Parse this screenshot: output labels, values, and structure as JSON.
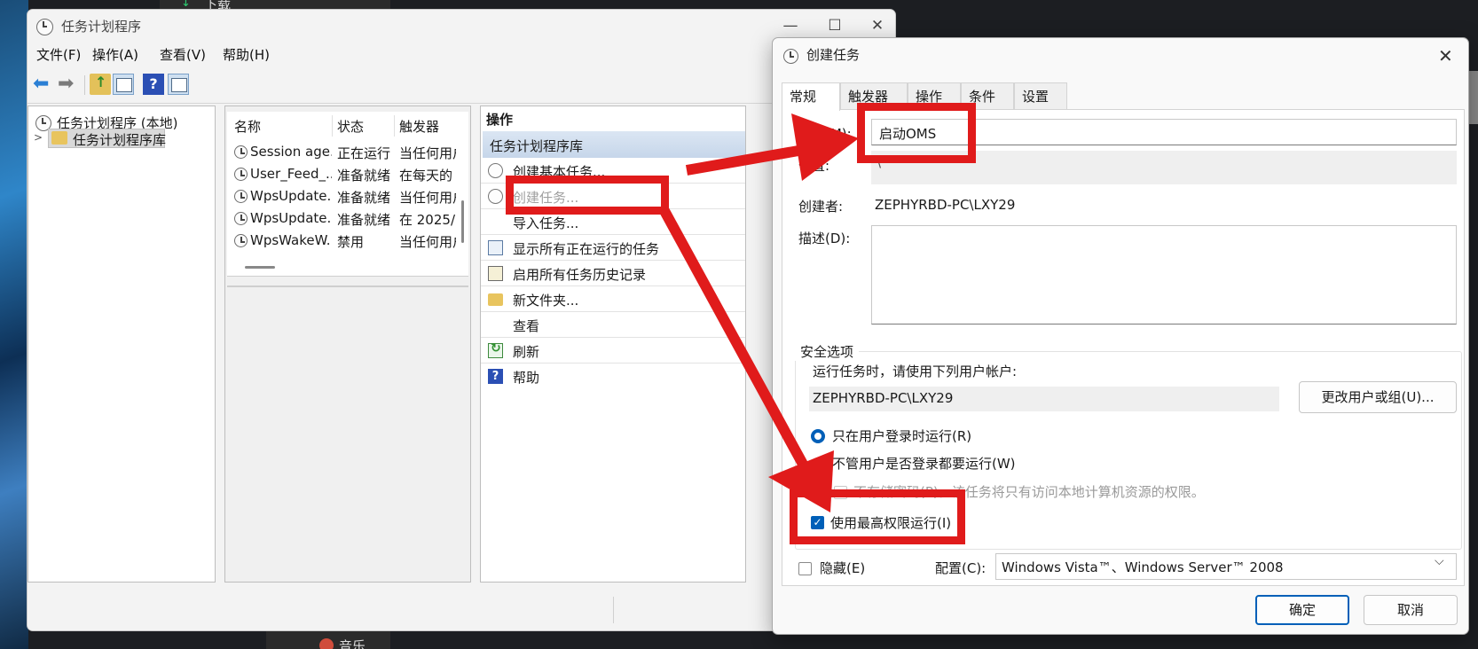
{
  "desktop": {
    "top_label": "下载",
    "bottom_label": "音乐"
  },
  "main_window": {
    "title": "任务计划程序",
    "controls": {
      "minimize": "—",
      "maximize": "☐",
      "close": "✕"
    },
    "menu": [
      "文件(F)",
      "操作(A)",
      "查看(V)",
      "帮助(H)"
    ],
    "tree": {
      "root": "任务计划程序 (本地)",
      "child": "任务计划程序库"
    },
    "task_list": {
      "columns": [
        "名称",
        "状态",
        "触发器"
      ],
      "rows": [
        {
          "name": "Session age...",
          "status": "正在运行",
          "trigger": "当任何用户"
        },
        {
          "name": "User_Feed_...",
          "status": "准备就绪",
          "trigger": "在每天的"
        },
        {
          "name": "WpsUpdate...",
          "status": "准备就绪",
          "trigger": "当任何用户"
        },
        {
          "name": "WpsUpdate...",
          "status": "准备就绪",
          "trigger": "在 2025/"
        },
        {
          "name": "WpsWakeW...",
          "status": "禁用",
          "trigger": "当任何用户"
        }
      ]
    },
    "actions": {
      "title": "操作",
      "section": "任务计划程序库",
      "items": [
        "创建基本任务...",
        "创建任务...",
        "导入任务...",
        "显示所有正在运行的任务",
        "启用所有任务历史记录",
        "新文件夹...",
        "查看",
        "刷新",
        "帮助"
      ]
    }
  },
  "dialog": {
    "title": "创建任务",
    "close": "✕",
    "tabs": [
      "常规",
      "触发器",
      "操作",
      "条件",
      "设置"
    ],
    "name_label": "名称(M):",
    "name_value": "启动OMS",
    "location_label": "位置:",
    "location_value": "\\",
    "author_label": "创建者:",
    "author_value": "ZEPHYRBD-PC\\LXY29",
    "description_label": "描述(D):",
    "security": {
      "title": "安全选项",
      "run_as_label": "运行任务时，请使用下列用户帐户:",
      "run_as_user": "ZEPHYRBD-PC\\LXY29",
      "change_button": "更改用户或组(U)...",
      "radio_logged_on": "只在用户登录时运行(R)",
      "radio_whether": "不管用户是否登录都要运行(W)",
      "no_store_password": "不存储密码(P)。该任务将只有访问本地计算机资源的权限。",
      "highest_privileges": "使用最高权限运行(I)"
    },
    "hidden_label": "隐藏(E)",
    "config_label": "配置(C):",
    "config_value": "Windows Vista™、Windows Server™ 2008",
    "ok": "确定",
    "cancel": "取消"
  },
  "colors": {
    "annotation_red": "#e01b1b",
    "accent_blue": "#005fb8"
  }
}
